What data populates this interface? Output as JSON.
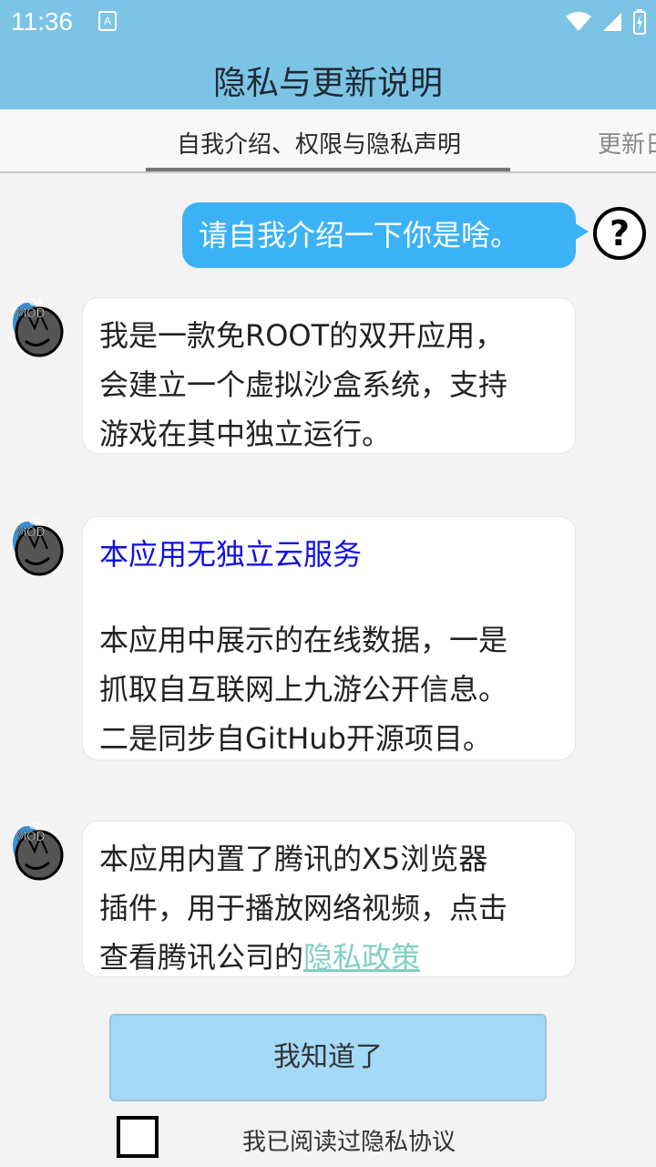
{
  "status_bar": {
    "time": "11:36",
    "notification_icon": "A"
  },
  "header": {
    "title": "隐私与更新说明"
  },
  "tabs": [
    {
      "label": "自我介绍、权限与隐私声明"
    },
    {
      "label": "更新日"
    }
  ],
  "messages": {
    "user": {
      "text": "请自我介绍一下你是啥。"
    },
    "bot_1": {
      "lines": [
        "我是一款免ROOT的双开应用，",
        "会建立一个虚拟沙盒系统，支持",
        "游戏在其中独立运行。"
      ]
    },
    "bot_2": {
      "title": "本应用无独立云服务",
      "lines": [
        "本应用中展示的在线数据，一是",
        "抓取自互联网上九游公开信息。",
        "二是同步自GitHub开源项目。"
      ]
    },
    "bot_3": {
      "lines": [
        "本应用内置了腾讯的X5浏览器",
        "插件，用于播放网络视频，点击"
      ],
      "last_prefix": "查看腾讯公司的",
      "link": "隐私政策"
    }
  },
  "bot_avatar_text": {
    "top": "GA",
    "bottom": "MOD"
  },
  "buttons": {
    "ok": "我知道了"
  },
  "checkbox": {
    "label": "我已阅读过隐私协议",
    "checked": false
  },
  "colors": {
    "header": "#7cc4e6",
    "user_bubble": "#3cb2f6",
    "title_blue": "#1010e6",
    "link": "#7fcfc8"
  }
}
